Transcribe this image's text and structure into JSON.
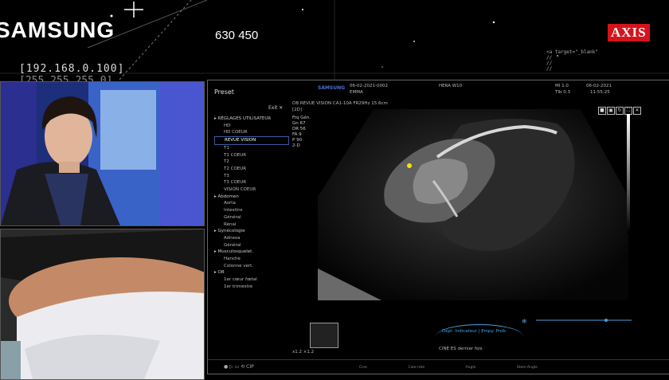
{
  "overlay": {
    "brand": "SAMSUNG",
    "counter": "630 450",
    "ip_line1": "[192.168.0.100]",
    "ip_line2": "[255.255.255.0]",
    "partner_logo": "AXIS",
    "code_snippet": "<a target=\"_blank\"\n//\n//\n//"
  },
  "ultrasound": {
    "preset_title": "Preset",
    "exit_label": "Exit ✕",
    "manufacturer": "SAMSUNG",
    "patient_id": "06-02-2021-0002",
    "patient_name": "EMMA",
    "probe_model": "HERA W10",
    "mi": "MI 1.0",
    "tis": "TIb 0.3",
    "date": "06-02-2021",
    "time": "11:55:25",
    "mode_line": "OB  REVUE VISION  CA1-10A  FR29Hz  15.6cm",
    "mode_tag": "[2D]",
    "params": [
      "Frq  Gén.",
      "Gn   67",
      "DR   56",
      "FA   9",
      "P    90",
      "2-D"
    ],
    "categories": [
      {
        "label": "RÉGLAGES UTILISATEUR",
        "items": [
          "HD",
          "HD COEUR",
          "REVUE VISION",
          "T1",
          "T1 COEUR",
          "T2",
          "T2 COEUR",
          "T3",
          "T3 COEUR",
          "VISION COEUR"
        ],
        "selected": "REVUE VISION"
      },
      {
        "label": "Abdomen",
        "items": [
          "Aorta",
          "Intestins",
          "Général",
          "Rénal"
        ]
      },
      {
        "label": "Gynécologie",
        "items": [
          "Adnexa",
          "Général"
        ]
      },
      {
        "label": "Musculosquelet.",
        "items": [
          "Hanche",
          "Colonne vert."
        ]
      },
      {
        "label": "OB",
        "items": [
          "1er cœur fœtal",
          "1er trimestre"
        ]
      }
    ],
    "thumb_label": "x1.2  ×1.2",
    "bottom_panel": "Dépl. indicateur  |  Empy. Prob.",
    "bottom_sub": "CINE         ES dernier fois",
    "bottom_labels": "Cine  Cale-rate  Angle  Steer-Angle",
    "colors": {
      "selected_border": "#3a5aa0",
      "marker": "#ffe100",
      "panel_border": "#666666"
    }
  },
  "camera": {
    "top": "presenter-camera",
    "bottom": "belly-scan-camera"
  }
}
